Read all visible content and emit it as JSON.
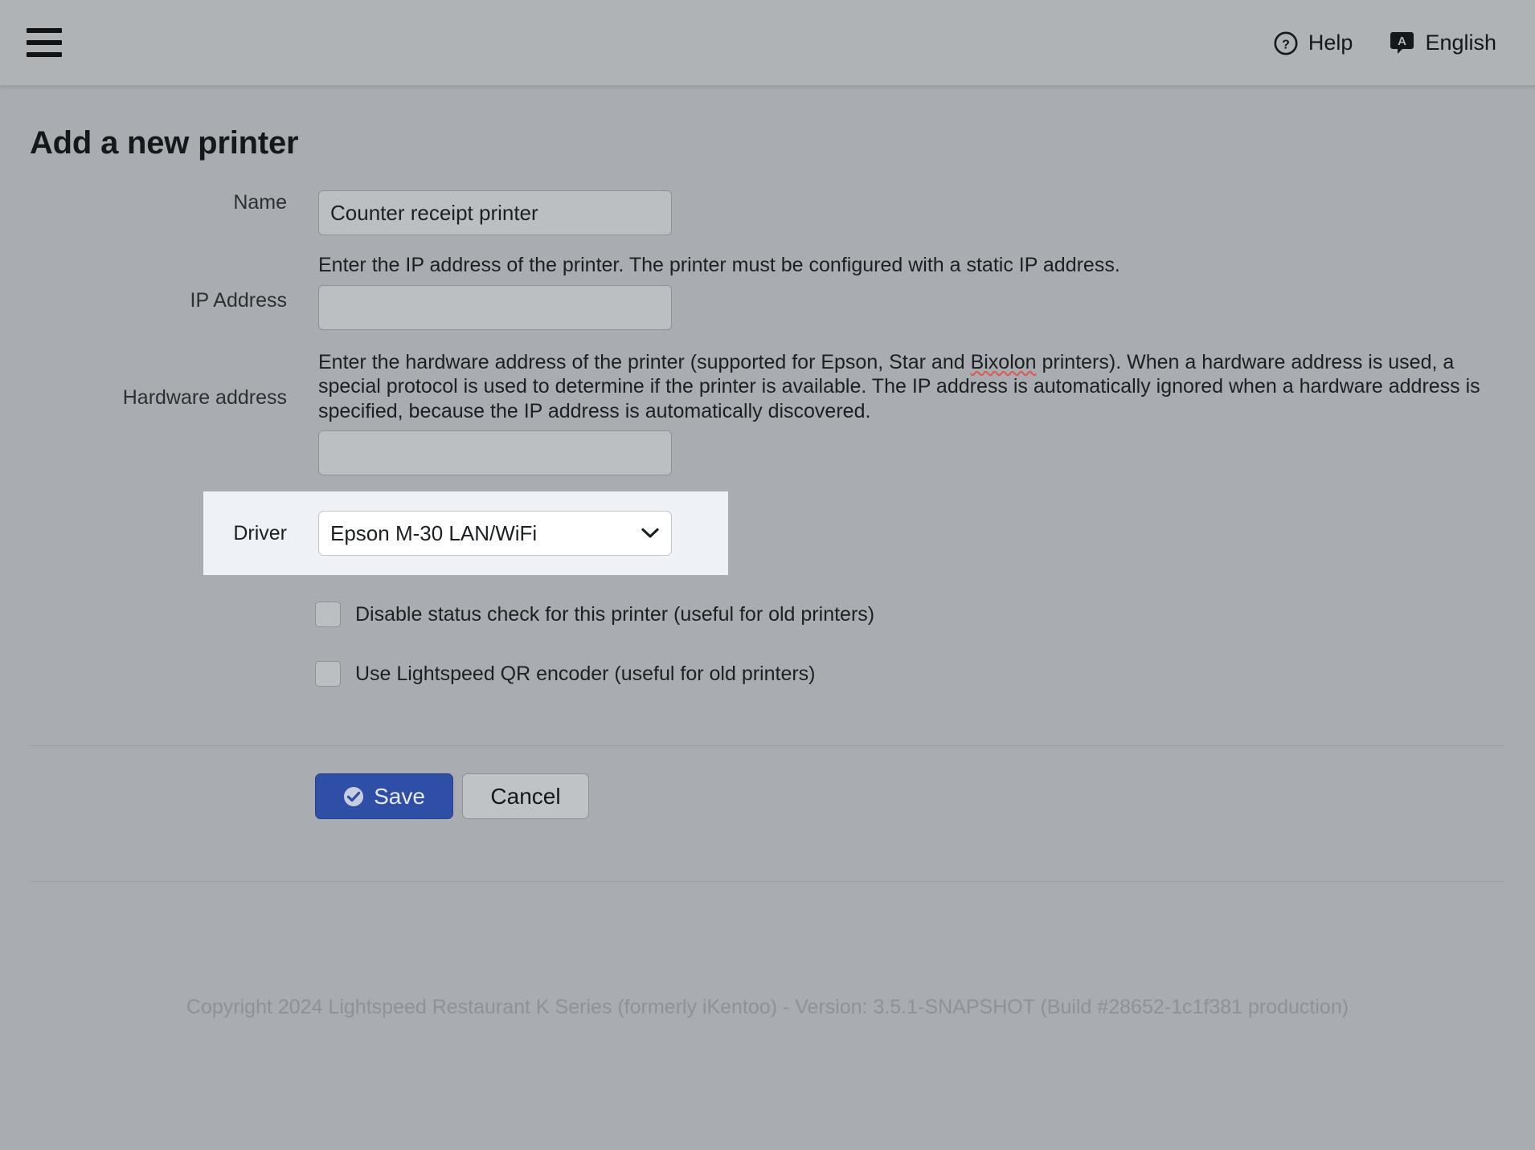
{
  "header": {
    "menu_icon": "hamburger-menu-icon",
    "help_label": "Help",
    "help_icon": "question-circle-icon",
    "language_label": "English",
    "language_icon": "language-bubble-icon"
  },
  "page": {
    "title": "Add a new printer"
  },
  "form": {
    "name": {
      "label": "Name",
      "value": "Counter receipt printer",
      "placeholder": ""
    },
    "ip_address": {
      "label": "IP Address",
      "help": "Enter the IP address of the printer. The printer must be configured with a static IP address.",
      "value": "",
      "placeholder": ""
    },
    "hardware_address": {
      "label": "Hardware address",
      "help_part1": "Enter the hardware address of the printer (supported for Epson, Star and ",
      "help_misspelled": "Bixolon",
      "help_part2": " printers). When a hardware address is used, a special protocol is used to determine if the printer is available. The IP address is automatically ignored when a hardware address is specified, because the IP address is automatically discovered.",
      "value": "",
      "placeholder": ""
    },
    "driver": {
      "label": "Driver",
      "selected": "Epson M-30 LAN/WiFi",
      "options": [
        "Epson M-30 LAN/WiFi"
      ],
      "highlight_color": "#eef2f6"
    },
    "disable_status_check": {
      "label": "Disable status check for this printer (useful for old printers)",
      "checked": false
    },
    "use_qr_encoder": {
      "label": "Use Lightspeed QR encoder (useful for old printers)",
      "checked": false
    }
  },
  "actions": {
    "save_label": "Save",
    "save_icon": "check-circle-icon",
    "save_color": "#2f4ea5",
    "cancel_label": "Cancel"
  },
  "footer": {
    "copyright": "Copyright 2024 Lightspeed Restaurant K Series (formerly iKentoo) - Version: 3.5.1-SNAPSHOT (Build #28652-1c1f381 production)"
  }
}
